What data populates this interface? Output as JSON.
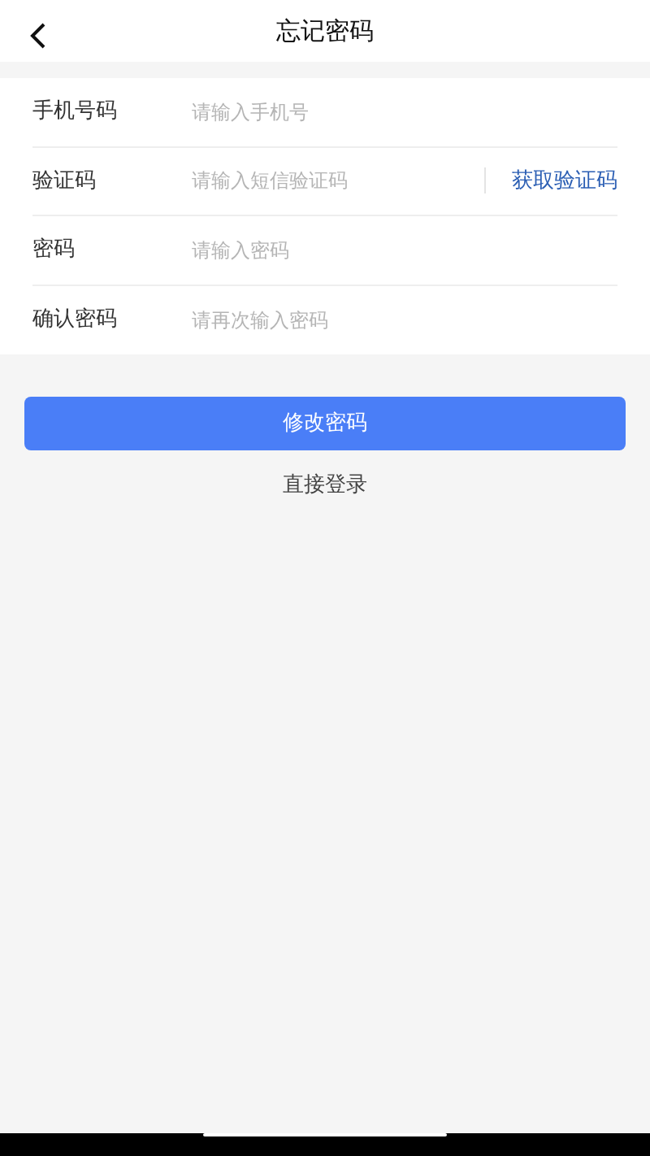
{
  "header": {
    "title": "忘记密码"
  },
  "fields": [
    {
      "label": "手机号码",
      "placeholder": "请输入手机号"
    },
    {
      "label": "验证码",
      "placeholder": "请输入短信验证码",
      "action": "获取验证码"
    },
    {
      "label": "密码",
      "placeholder": "请输入密码"
    },
    {
      "label": "确认密码",
      "placeholder": "请再次输入密码"
    }
  ],
  "submit_button": "修改密码",
  "login_link": "直接登录"
}
